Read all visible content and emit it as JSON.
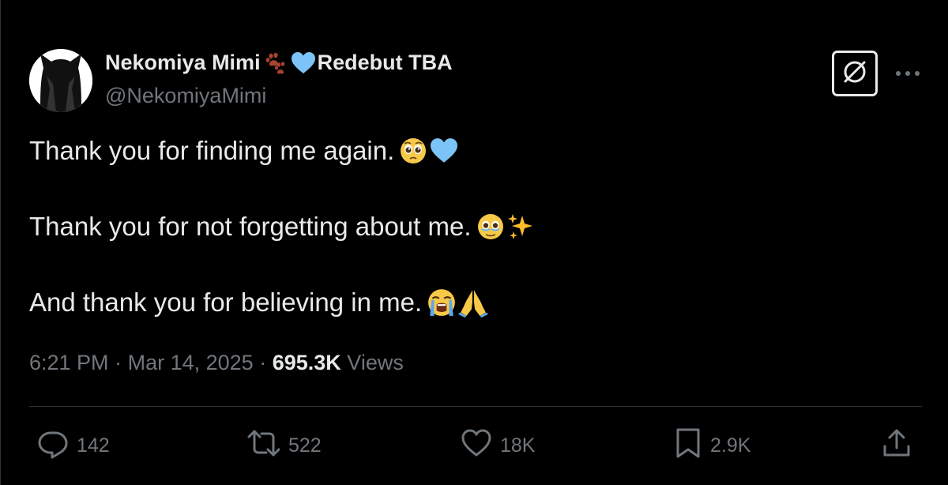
{
  "user": {
    "display_name": "Nekomiya Mimi",
    "display_name_suffix": "Redebut TBA",
    "name_emojis": [
      "paw-prints-emoji",
      "light-blue-heart-emoji"
    ],
    "handle": "@NekomiyaMimi"
  },
  "tweet": {
    "lines": [
      {
        "text": "Thank you for finding me again.",
        "emojis": [
          "pleading-face-emoji",
          "light-blue-heart-emoji"
        ]
      },
      {
        "text": "Thank you for not forgetting about me.",
        "emojis": [
          "face-holding-back-tears-emoji",
          "sparkles-emoji"
        ]
      },
      {
        "text": "And thank you for believing in me.",
        "emojis": [
          "loudly-crying-face-emoji",
          "folded-hands-emoji"
        ]
      }
    ],
    "time": "6:21 PM",
    "date": "Mar 14, 2025",
    "views_count": "695.3K",
    "views_label": "Views"
  },
  "actions": {
    "replies": "142",
    "reposts": "522",
    "likes": "18K",
    "bookmarks": "2.9K"
  },
  "icons": {
    "header": [
      "grok-icon",
      "more-icon"
    ],
    "actions": [
      "reply-icon",
      "repost-icon",
      "like-icon",
      "bookmark-icon",
      "share-icon"
    ]
  },
  "colors": {
    "background": "#000000",
    "primary_text": "#e7e9ea",
    "secondary_text": "#71767b",
    "divider": "#2f3336",
    "blue_heart": "#7cc4f7"
  }
}
